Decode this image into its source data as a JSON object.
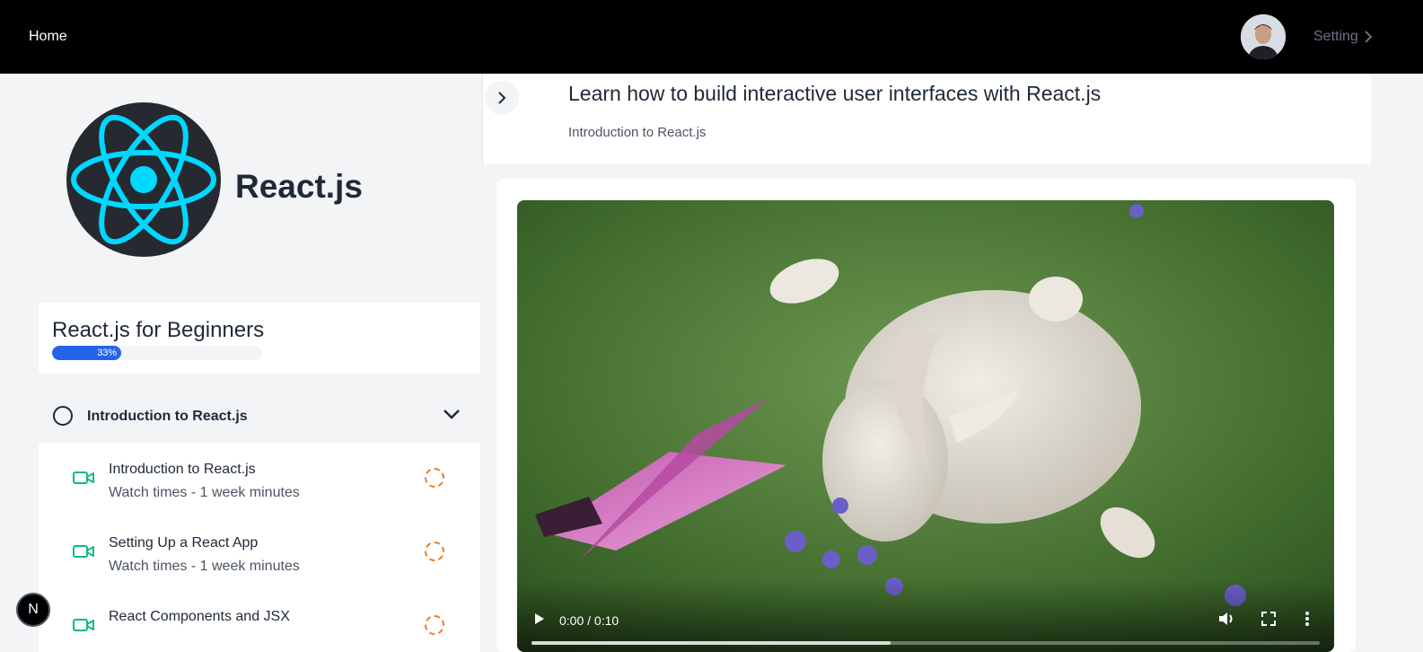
{
  "nav": {
    "home_label": "Home",
    "setting_label": "Setting"
  },
  "course": {
    "name": "React.js",
    "title": "React.js for Beginners",
    "progress_percent": 33,
    "progress_label": "33%"
  },
  "section": {
    "title": "Introduction to React.js",
    "expanded": true
  },
  "lessons": [
    {
      "title": "Introduction to React.js",
      "subtitle": "Watch times - 1 week minutes",
      "icon": "video-icon",
      "status": "not-started"
    },
    {
      "title": "Setting Up a React App",
      "subtitle": "Watch times - 1 week minutes",
      "icon": "video-icon",
      "status": "not-started"
    },
    {
      "title": "React Components and JSX",
      "subtitle": "",
      "icon": "video-icon",
      "status": "not-started"
    }
  ],
  "main": {
    "heading": "Learn how to build interactive user interfaces with React.js",
    "subheading": "Introduction to React.js"
  },
  "video": {
    "time_label": "0:00 / 0:10"
  },
  "badge": {
    "label": "N"
  },
  "colors": {
    "accent": "#2563eb",
    "lesson_icon": "#10b981",
    "status_pending": "#f97316",
    "react_logo": "#00d8ff"
  }
}
